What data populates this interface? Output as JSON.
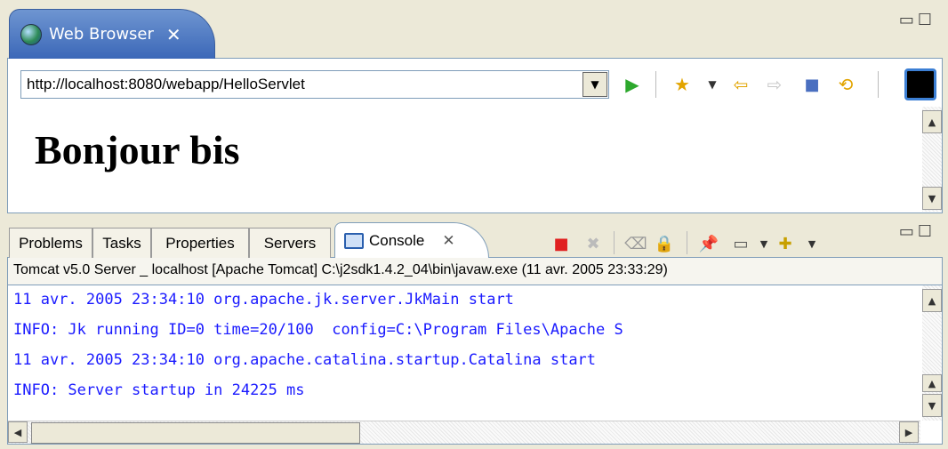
{
  "browser": {
    "tab_title": "Web Browser",
    "url": "http://localhost:8080/webapp/HelloServlet",
    "page_heading": "Bonjour bis",
    "toolbar_icons": [
      "go-icon",
      "favorites-icon",
      "dropdown-icon",
      "back-icon",
      "forward-icon",
      "stop-icon",
      "refresh-icon"
    ]
  },
  "console_view": {
    "tabs": [
      {
        "label": "Problems"
      },
      {
        "label": "Tasks"
      },
      {
        "label": "Properties"
      },
      {
        "label": "Servers"
      },
      {
        "label": "Console"
      }
    ],
    "process_label": "Tomcat v5.0 Server _ localhost [Apache Tomcat] C:\\j2sdk1.4.2_04\\bin\\javaw.exe (11 avr. 2005 23:33:29)",
    "lines": [
      "11 avr. 2005 23:34:10 org.apache.jk.server.JkMain start",
      "INFO: Jk running ID=0 time=20/100  config=C:\\Program Files\\Apache S",
      "11 avr. 2005 23:34:10 org.apache.catalina.startup.Catalina start",
      "INFO: Server startup in 24225 ms"
    ],
    "colors": {
      "output_text": "#1a1aff"
    }
  }
}
